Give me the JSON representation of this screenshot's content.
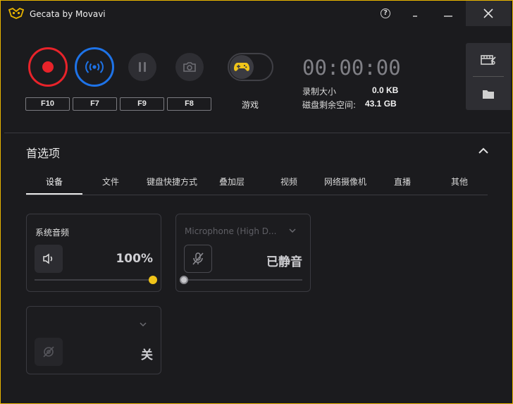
{
  "app": {
    "title": "Gecata by Movavi"
  },
  "titlebar": {
    "help": "?",
    "minimize": "_",
    "maximize": "—",
    "close": "✕"
  },
  "hotkeys": {
    "record": "F10",
    "stream": "F7",
    "pause": "F9",
    "screenshot": "F8"
  },
  "game_mode": {
    "label": "游戏"
  },
  "status": {
    "timer": "00:00:00",
    "record_size_label": "录制大小",
    "record_size_value": "0.0 KB",
    "disk_free_label": "磁盘剩余空间:",
    "disk_free_value": "43.1 GB"
  },
  "preferences": {
    "title": "首选项",
    "tabs": [
      "设备",
      "文件",
      "键盘快捷方式",
      "叠加层",
      "视频",
      "网络摄像机",
      "直播",
      "其他"
    ],
    "active_tab": 0
  },
  "devices": {
    "system_audio": {
      "title": "系统音频",
      "value": "100%",
      "level": 1.0
    },
    "microphone": {
      "title": "Microphone (High D...",
      "value": "已静音",
      "level": 0.0
    },
    "webcam": {
      "value": "关"
    }
  },
  "colors": {
    "accent": "#e8b400",
    "record": "#e8232a",
    "stream": "#1e73e8",
    "knob_active": "#f0c419",
    "knob_muted": "#c8c8cc"
  }
}
